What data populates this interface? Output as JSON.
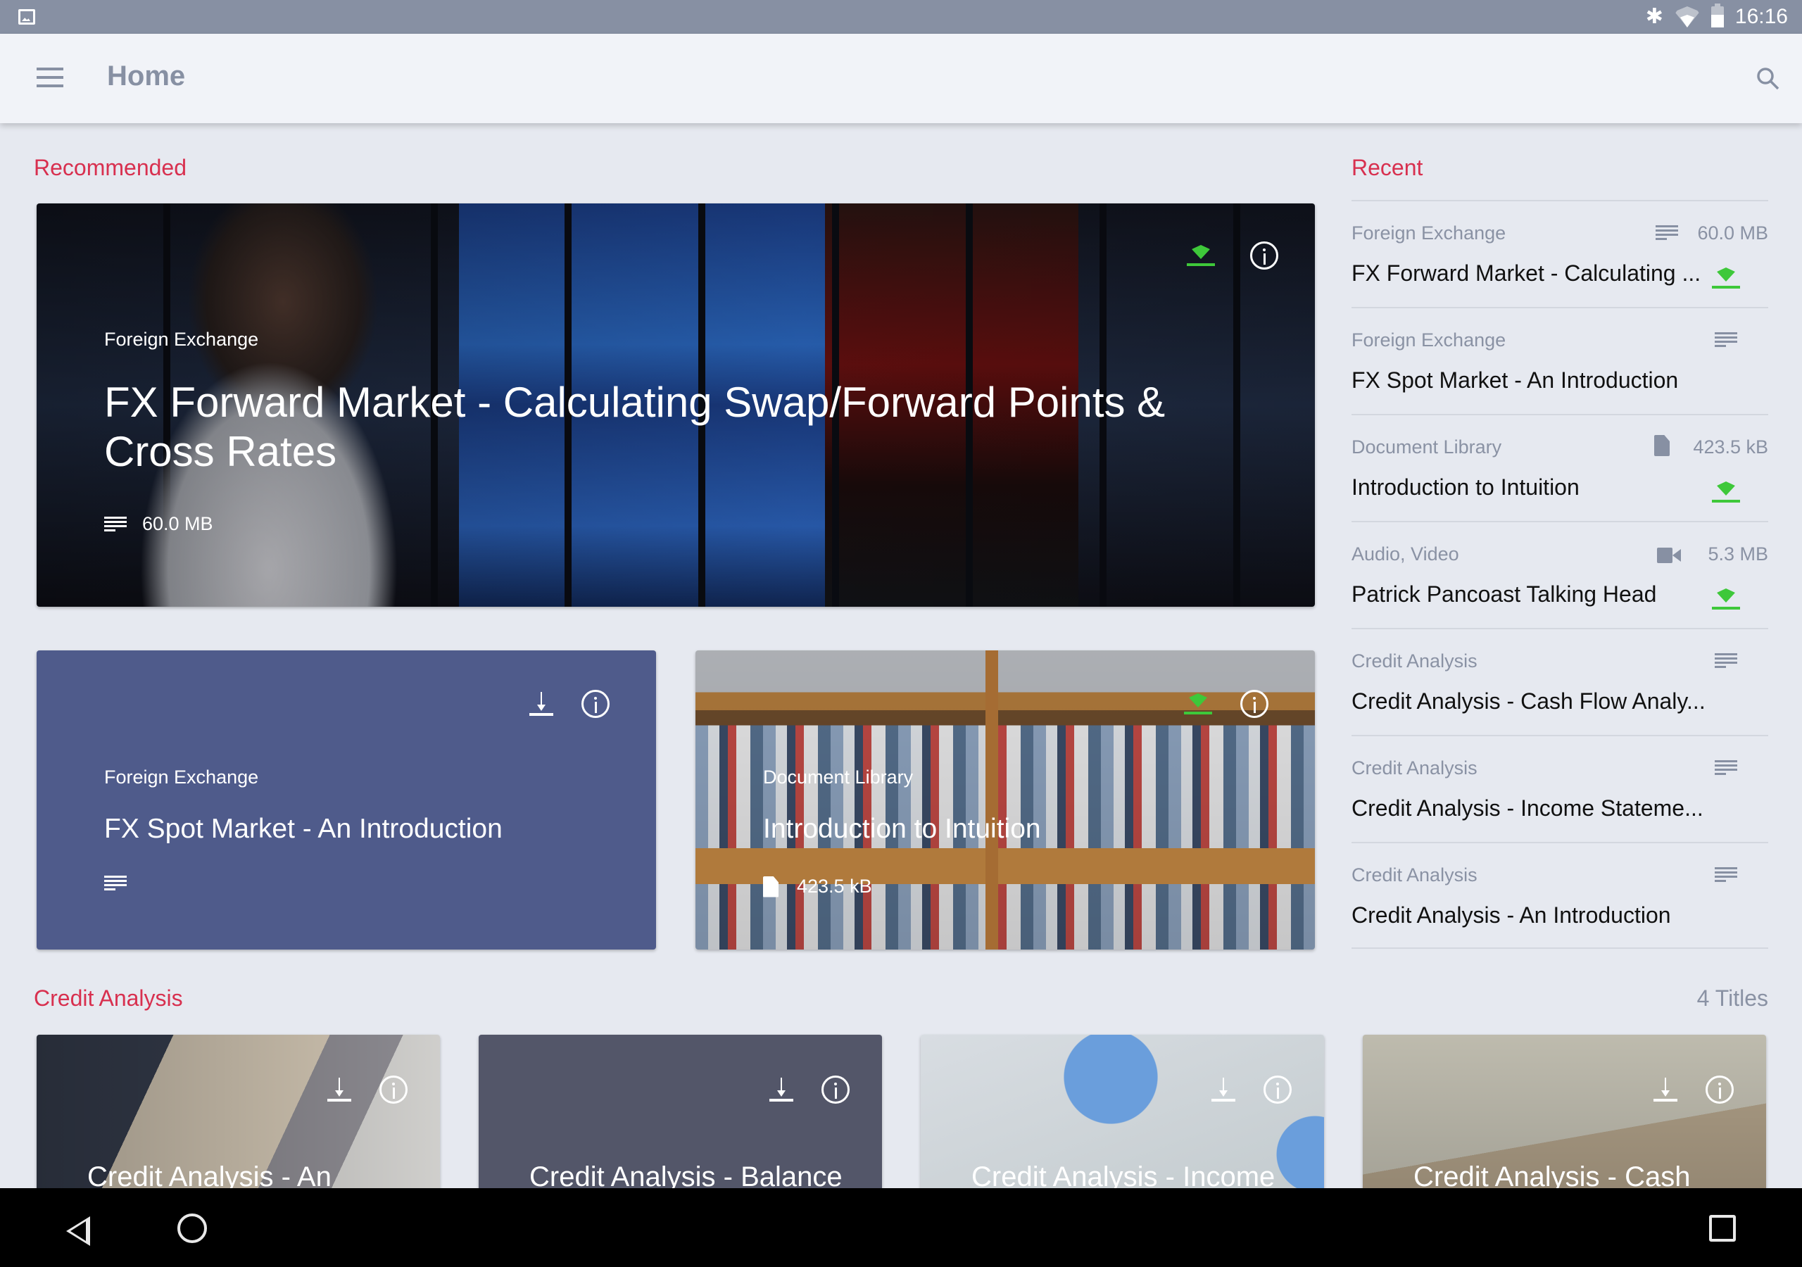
{
  "status_bar": {
    "time": "16:16",
    "icons": [
      "image-notification-icon",
      "bluetooth-icon",
      "wifi-icon",
      "battery-icon"
    ]
  },
  "app_bar": {
    "title": "Home",
    "menu_icon": "menu-icon",
    "search_icon": "search-icon"
  },
  "colors": {
    "accent": "#d8304f",
    "status_bar": "#8790a3",
    "app_bar": "#f1f3f8",
    "background": "#e6e9f0",
    "offline_green": "#3ec83a",
    "fx_card": "#4f5b8b",
    "balance_card": "#535669"
  },
  "recommended": {
    "heading": "Recommended",
    "hero": {
      "category": "Foreign Exchange",
      "title": "FX Forward Market - Calculating Swap/Forward Points & Cross Rates",
      "type_icon": "document-lines-icon",
      "size": "60.0 MB",
      "available_offline": true
    },
    "cards": [
      {
        "category": "Foreign Exchange",
        "title": "FX Spot Market - An Introduction",
        "type_icon": "document-lines-icon",
        "size": "",
        "available_offline": false
      },
      {
        "category": "Document Library",
        "title": "Introduction to Intuition",
        "type_icon": "file-icon",
        "size": "423.5 kB",
        "available_offline": true
      }
    ]
  },
  "recent": {
    "heading": "Recent",
    "items": [
      {
        "category": "Foreign Exchange",
        "title": "FX Forward Market - Calculating ...",
        "type_icon": "document-lines-icon",
        "size": "60.0 MB",
        "available_offline": true
      },
      {
        "category": "Foreign Exchange",
        "title": "FX Spot Market - An Introduction",
        "type_icon": "document-lines-icon",
        "size": "",
        "available_offline": false
      },
      {
        "category": "Document Library",
        "title": "Introduction to Intuition",
        "type_icon": "file-icon",
        "size": "423.5 kB",
        "available_offline": true
      },
      {
        "category": "Audio, Video",
        "title": "Patrick Pancoast Talking Head",
        "type_icon": "video-icon",
        "size": "5.3 MB",
        "available_offline": true
      },
      {
        "category": "Credit Analysis",
        "title": "Credit Analysis - Cash Flow Analy...",
        "type_icon": "document-lines-icon",
        "size": "",
        "available_offline": false
      },
      {
        "category": "Credit Analysis",
        "title": "Credit Analysis - Income Stateme...",
        "type_icon": "document-lines-icon",
        "size": "",
        "available_offline": false
      },
      {
        "category": "Credit Analysis",
        "title": "Credit Analysis - An Introduction",
        "type_icon": "document-lines-icon",
        "size": "",
        "available_offline": false
      }
    ]
  },
  "credit_analysis": {
    "heading": "Credit Analysis",
    "count": "4 Titles",
    "cards": [
      {
        "title": "Credit Analysis - An"
      },
      {
        "title": "Credit Analysis - Balance"
      },
      {
        "title": "Credit Analysis - Income"
      },
      {
        "title": "Credit Analysis - Cash"
      }
    ]
  },
  "nav_bar": {
    "buttons": [
      "back",
      "home",
      "recents"
    ]
  }
}
